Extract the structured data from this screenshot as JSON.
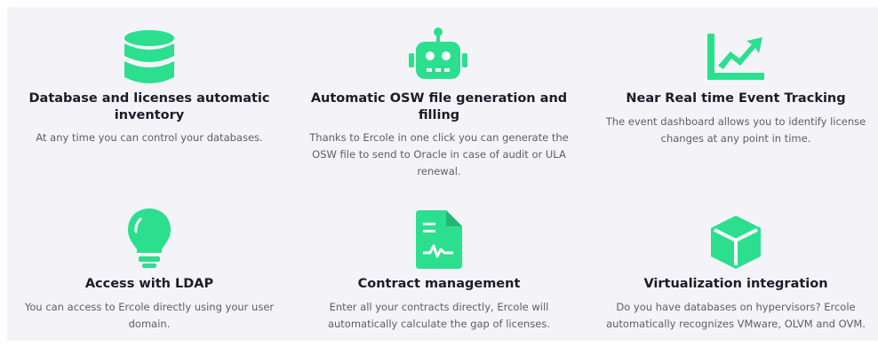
{
  "colors": {
    "accent": "#2bdf8e",
    "title": "#1c1c28",
    "text": "#5a5e6a",
    "panel": "#f4f4f8"
  },
  "features": [
    {
      "icon": "database-icon",
      "title": "Database and licenses automatic inventory",
      "description": "At any time you can control your databases."
    },
    {
      "icon": "robot-icon",
      "title": "Automatic OSW file generation and filling",
      "description": "Thanks to Ercole in one click you can generate the OSW file to send to Oracle in case of audit or ULA renewal."
    },
    {
      "icon": "chart-line-icon",
      "title": "Near Real time Event Tracking",
      "description": "The event dashboard allows you to identify license changes at any point in time."
    },
    {
      "icon": "lightbulb-icon",
      "title": "Access with LDAP",
      "description": "You can access to Ercole directly using your user domain."
    },
    {
      "icon": "contract-document-icon",
      "title": "Contract management",
      "description": "Enter all your contracts directly, Ercole will automatically calculate the gap of licenses."
    },
    {
      "icon": "cube-icon",
      "title": "Virtualization integration",
      "description": "Do you have databases on hypervisors? Ercole automatically recognizes VMware, OLVM and OVM."
    }
  ]
}
